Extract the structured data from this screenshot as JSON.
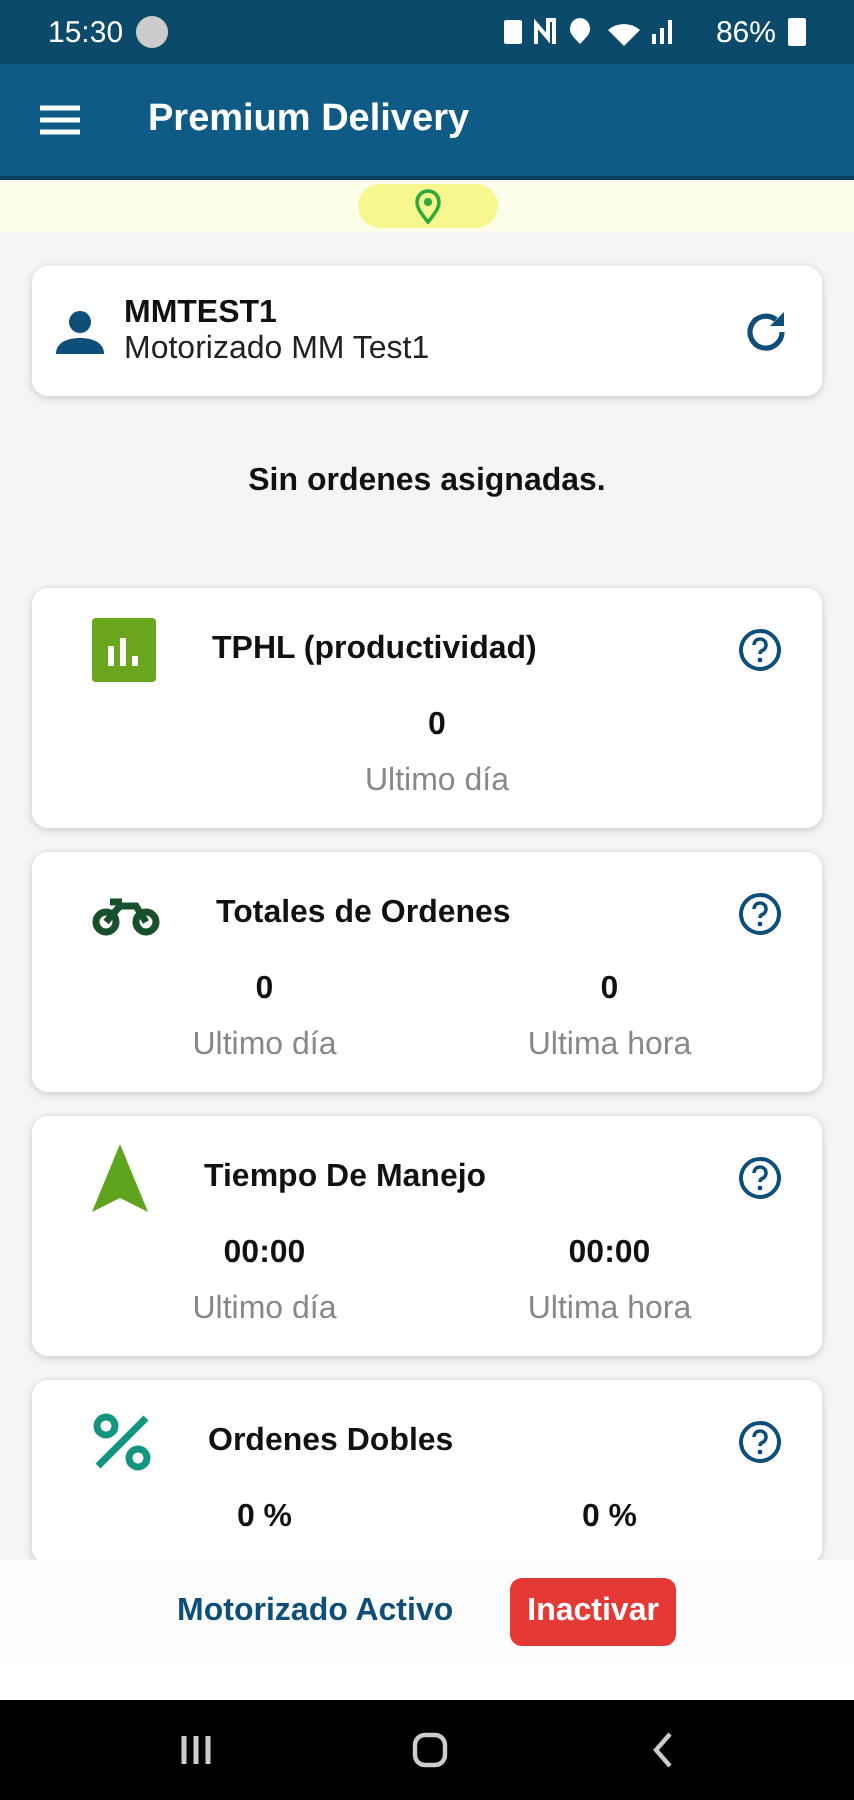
{
  "status_bar": {
    "time": "15:30",
    "battery": "86%"
  },
  "app_bar": {
    "title": "Premium Delivery"
  },
  "user": {
    "code": "MMTEST1",
    "name": "Motorizado MM Test1"
  },
  "message": "Sin ordenes asignadas.",
  "cards": [
    {
      "kind": "chart",
      "title": "TPHL (productividad)",
      "stats": [
        {
          "value": "0",
          "label": "Ultimo día"
        }
      ]
    },
    {
      "kind": "moto",
      "title": "Totales de Ordenes",
      "stats": [
        {
          "value": "0",
          "label": "Ultimo día"
        },
        {
          "value": "0",
          "label": "Ultima hora"
        }
      ]
    },
    {
      "kind": "navigation",
      "title": "Tiempo De Manejo",
      "stats": [
        {
          "value": "00:00",
          "label": "Ultimo día"
        },
        {
          "value": "00:00",
          "label": "Ultima hora"
        }
      ]
    },
    {
      "kind": "percent",
      "title": "Ordenes Dobles",
      "stats": [
        {
          "value": "0 %"
        },
        {
          "value": "0 %"
        }
      ]
    }
  ],
  "footer": {
    "status": "Motorizado Activo",
    "button": "Inactivar"
  }
}
